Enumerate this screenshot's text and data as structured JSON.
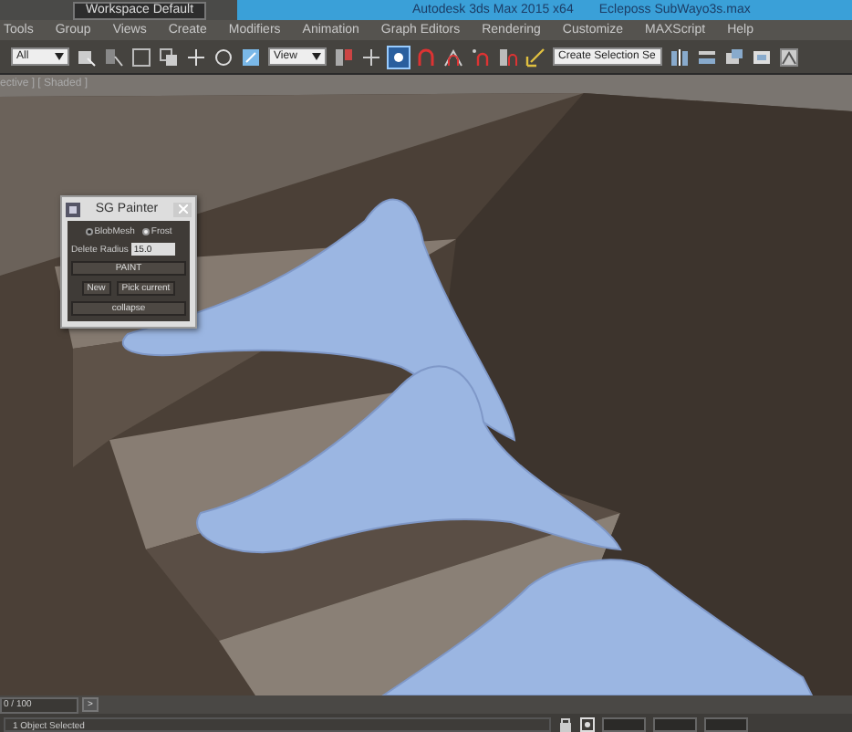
{
  "title_bar": {
    "workspace": "Workspace Default",
    "app_title": "Autodesk 3ds Max 2015 x64",
    "file_name": "Ecleposs SubWayo3s.max"
  },
  "menu": [
    "Tools",
    "Group",
    "Views",
    "Create",
    "Modifiers",
    "Animation",
    "Graph Editors",
    "Rendering",
    "Customize",
    "MAXScript",
    "Help"
  ],
  "toolbar": {
    "selection_filter": "All",
    "reference_coord": "View",
    "named_selection": "Create Selection Se"
  },
  "viewport": {
    "label": "ective ] [ Shaded ]"
  },
  "painter": {
    "title": "SG Painter",
    "modes": [
      {
        "label": "BlobMesh",
        "selected": false
      },
      {
        "label": "Frost",
        "selected": true
      }
    ],
    "radius_label": "Delete Radius",
    "radius_value": "15.0",
    "buttons": [
      "PAINT",
      "New",
      "Pick current",
      "collapse"
    ]
  },
  "timeline": {
    "frame": "0 / 100",
    "next": ">"
  },
  "status": {
    "message": "1 Object Selected"
  }
}
